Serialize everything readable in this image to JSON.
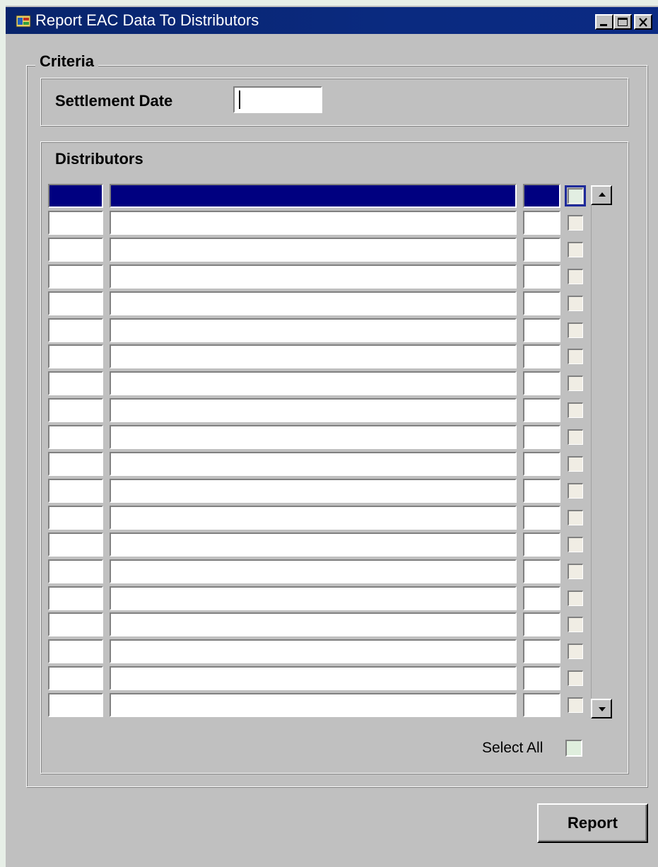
{
  "window": {
    "title": "Report EAC Data To Distributors",
    "icon": "oracle-forms-app-icon",
    "controls": [
      "minimize-icon",
      "maximize-icon",
      "close-icon"
    ]
  },
  "criteria": {
    "label": "Criteria",
    "settlement_date": {
      "label": "Settlement Date",
      "value": ""
    },
    "distributors": {
      "label": "Distributors",
      "row_count": 20,
      "selected_row": 1,
      "rows": []
    },
    "select_all": {
      "label": "Select All",
      "checked": false
    }
  },
  "actions": {
    "report_label": "Report"
  },
  "colors": {
    "title_bar": "#0a2a80",
    "selection": "#000080",
    "face": "#c0c0c0"
  }
}
